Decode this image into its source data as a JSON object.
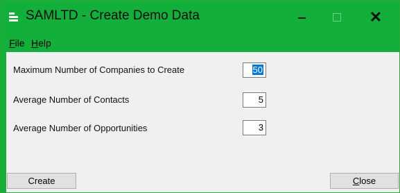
{
  "window": {
    "title": "SAMLTD - Create Demo Data",
    "accent_color": "#12b03a"
  },
  "titlebar": {
    "min_icon": "minimize-icon",
    "max_icon": "maximize-icon",
    "close_glyph": "✕"
  },
  "menu": {
    "file_letter": "F",
    "file_rest": "ile",
    "help_letter": "H",
    "help_rest": "elp"
  },
  "form": {
    "rows": [
      {
        "label": "Maximum Number of Companies to Create",
        "value": "50"
      },
      {
        "label": "Average Number of Contacts",
        "value": "5"
      },
      {
        "label": "Average Number of Opportunities",
        "value": "3"
      }
    ]
  },
  "buttons": {
    "create_letter": "C",
    "create_rest": "reate",
    "close_letter": "C",
    "close_rest": "lose"
  }
}
